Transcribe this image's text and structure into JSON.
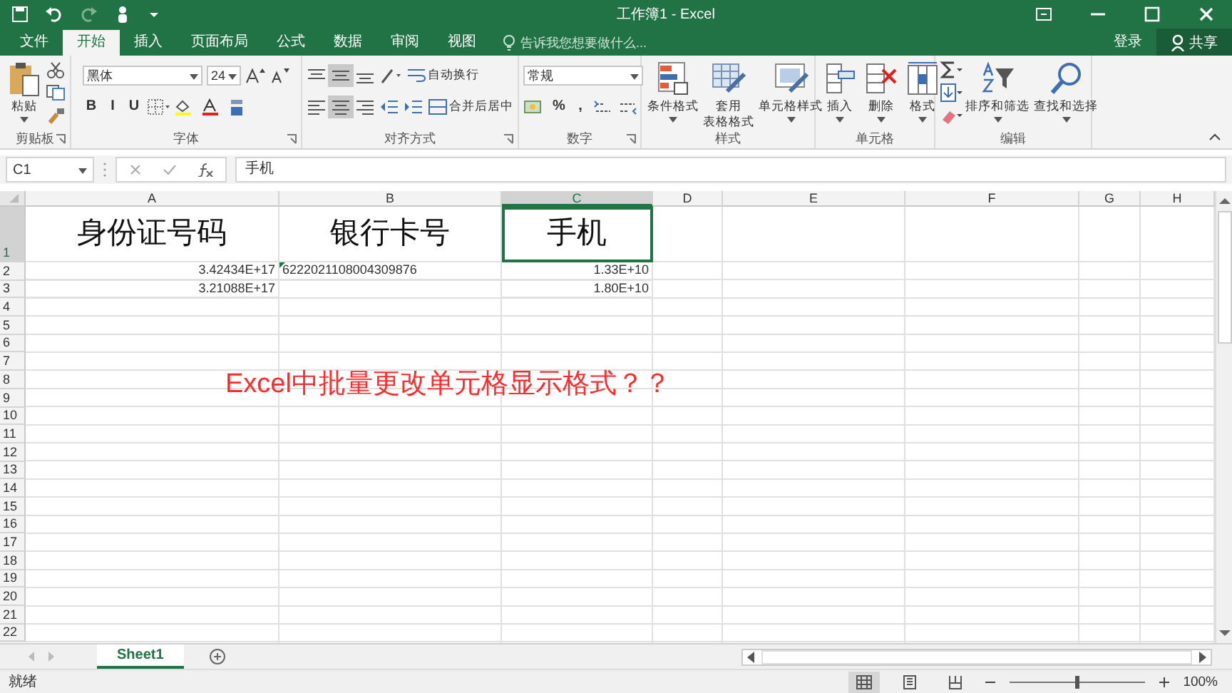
{
  "window": {
    "title": "工作簿1 - Excel",
    "sign_in": "登录",
    "share": "共享"
  },
  "tabs": [
    {
      "label": "文件",
      "selected": false
    },
    {
      "label": "开始",
      "selected": true
    },
    {
      "label": "插入",
      "selected": false
    },
    {
      "label": "页面布局",
      "selected": false
    },
    {
      "label": "公式",
      "selected": false
    },
    {
      "label": "数据",
      "selected": false
    },
    {
      "label": "审阅",
      "selected": false
    },
    {
      "label": "视图",
      "selected": false
    }
  ],
  "tell_me": {
    "placeholder": "告诉我您想要做什么..."
  },
  "ribbon": [
    {
      "label": "剪贴板",
      "launcher": true,
      "parts": [
        {
          "kind": "large",
          "lines": [
            "粘贴"
          ],
          "caret": true
        },
        {
          "kind": "stack",
          "rows": [
            [
              {
                "kind": "icon"
              }
            ],
            [
              {
                "kind": "icon"
              }
            ],
            [
              {
                "kind": "icon"
              }
            ]
          ]
        }
      ]
    },
    {
      "label": "字体",
      "launcher": true,
      "parts": [
        {
          "kind": "stack",
          "rows": [
            [
              {
                "kind": "dropdown",
                "value": "黑体",
                "wide": true
              },
              {
                "kind": "dropdown",
                "value": "24",
                "wide": false
              },
              {
                "kind": "icon"
              },
              {
                "kind": "icon"
              }
            ],
            [
              {
                "kind": "text",
                "text": "B"
              },
              {
                "kind": "text",
                "text": "I"
              },
              {
                "kind": "text",
                "text": "U"
              },
              {
                "kind": "icon"
              },
              {
                "kind": "icon"
              },
              {
                "kind": "icon"
              },
              {
                "kind": "icon"
              }
            ]
          ]
        }
      ]
    },
    {
      "label": "对齐方式",
      "launcher": true,
      "parts": [
        {
          "kind": "stack",
          "rows": [
            [
              {
                "kind": "icon",
                "selected": false
              },
              {
                "kind": "icon",
                "selected": true
              },
              {
                "kind": "icon",
                "selected": false
              },
              {
                "kind": "icon",
                "selected": false
              },
              {
                "kind": "labeled",
                "text": "自动换行"
              }
            ],
            [
              {
                "kind": "icon",
                "selected": false
              },
              {
                "kind": "icon",
                "selected": true
              },
              {
                "kind": "icon",
                "selected": false
              },
              {
                "kind": "icon",
                "selected": false
              },
              {
                "kind": "icon",
                "selected": false
              },
              {
                "kind": "labeled",
                "text": "合并后居中"
              }
            ]
          ]
        }
      ]
    },
    {
      "label": "数字",
      "launcher": true,
      "parts": [
        {
          "kind": "stack",
          "rows": [
            [
              {
                "kind": "dropdown",
                "value": "常规",
                "wide": true
              }
            ],
            [
              {
                "kind": "icon"
              },
              {
                "kind": "text",
                "text": "%"
              },
              {
                "kind": "text",
                "text": ","
              },
              {
                "kind": "icon"
              },
              {
                "kind": "icon"
              }
            ]
          ]
        }
      ]
    },
    {
      "label": "样式",
      "launcher": false,
      "parts": [
        {
          "kind": "large",
          "lines": [
            "条件格式"
          ],
          "caret": true
        },
        {
          "kind": "large",
          "lines": [
            "套用",
            "表格格式"
          ],
          "caret": false
        },
        {
          "kind": "large",
          "lines": [
            "单元格样式"
          ],
          "caret": true
        }
      ]
    },
    {
      "label": "单元格",
      "launcher": false,
      "parts": [
        {
          "kind": "large",
          "lines": [
            "插入"
          ],
          "caret": true
        },
        {
          "kind": "large",
          "lines": [
            "删除"
          ],
          "caret": true
        },
        {
          "kind": "large",
          "lines": [
            "格式"
          ],
          "caret": true
        }
      ]
    },
    {
      "label": "编辑",
      "launcher": false,
      "parts": [
        {
          "kind": "stack",
          "rows": [
            [
              {
                "kind": "icon"
              }
            ],
            [
              {
                "kind": "icon"
              }
            ],
            [
              {
                "kind": "icon"
              }
            ]
          ]
        },
        {
          "kind": "large",
          "lines": [
            "排序和筛选"
          ],
          "caret": true
        },
        {
          "kind": "large",
          "lines": [
            "查找和选择"
          ],
          "caret": true
        }
      ]
    }
  ],
  "formula_bar": {
    "name_box": "C1",
    "formula": "手机"
  },
  "sheet": {
    "columns": [
      {
        "label": "A",
        "selected": false
      },
      {
        "label": "B",
        "selected": false
      },
      {
        "label": "C",
        "selected": true
      },
      {
        "label": "D",
        "selected": false
      },
      {
        "label": "E",
        "selected": false
      },
      {
        "label": "F",
        "selected": false
      },
      {
        "label": "G",
        "selected": false
      },
      {
        "label": "H",
        "selected": false
      }
    ],
    "rows": [
      {
        "label": "1",
        "selected": true,
        "cells": [
          {
            "kind": "heading",
            "text": "身份证号码",
            "selected": false,
            "flagged": false
          },
          {
            "kind": "heading",
            "text": "银行卡号",
            "selected": false,
            "flagged": false
          },
          {
            "kind": "heading",
            "text": "手机",
            "selected": true,
            "flagged": false
          }
        ]
      },
      {
        "label": "2",
        "selected": false,
        "cells": [
          {
            "kind": "number",
            "text": "3.42434E+17",
            "selected": false,
            "flagged": false
          },
          {
            "kind": "text",
            "text": "6222021108004309876",
            "selected": false,
            "flagged": true
          },
          {
            "kind": "number",
            "text": "1.33E+10",
            "selected": false,
            "flagged": false
          }
        ]
      },
      {
        "label": "3",
        "selected": false,
        "cells": [
          {
            "kind": "number",
            "text": "3.21088E+17",
            "selected": false,
            "flagged": false
          },
          null,
          {
            "kind": "number",
            "text": "1.80E+10",
            "selected": false,
            "flagged": false
          }
        ]
      },
      {
        "label": "4",
        "selected": false
      },
      {
        "label": "5",
        "selected": false
      },
      {
        "label": "6",
        "selected": false
      },
      {
        "label": "7",
        "selected": false
      },
      {
        "label": "8",
        "selected": false
      },
      {
        "label": "9",
        "selected": false
      },
      {
        "label": "10",
        "selected": false
      },
      {
        "label": "11",
        "selected": false
      },
      {
        "label": "12",
        "selected": false
      },
      {
        "label": "13",
        "selected": false
      },
      {
        "label": "14",
        "selected": false
      },
      {
        "label": "15",
        "selected": false
      },
      {
        "label": "16",
        "selected": false
      },
      {
        "label": "17",
        "selected": false
      },
      {
        "label": "18",
        "selected": false
      },
      {
        "label": "19",
        "selected": false
      },
      {
        "label": "20",
        "selected": false
      },
      {
        "label": "21",
        "selected": false
      },
      {
        "label": "22",
        "selected": false
      }
    ],
    "annotation": {
      "text": "Excel中批量更改单元格显示格式？？",
      "color": "#ff2b2b"
    }
  },
  "sheet_tabs": [
    {
      "label": "Sheet1",
      "selected": true
    }
  ],
  "status_bar": {
    "status": "就绪",
    "views": [
      {
        "selected": true
      },
      {
        "selected": false
      },
      {
        "selected": false
      }
    ],
    "zoom": {
      "level": 0.5,
      "reading": "100%"
    }
  }
}
